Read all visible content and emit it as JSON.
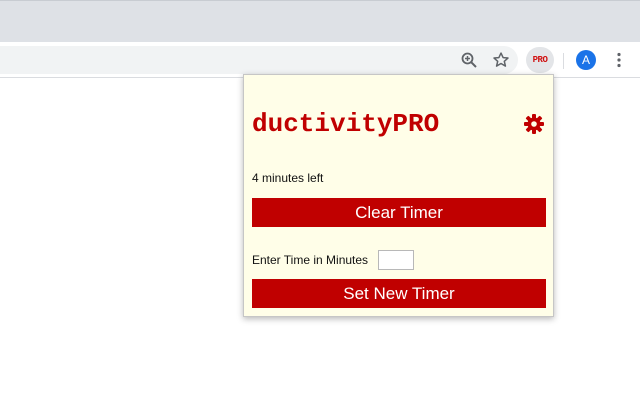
{
  "toolbar": {
    "zoom_icon": "zoom-in-icon",
    "bookmark_icon": "star-icon",
    "extension_badge": "PRO",
    "profile_initial": "A",
    "menu_icon": "more-vert-icon"
  },
  "popup": {
    "brand": "ductivityPRO",
    "settings_icon": "gear-icon",
    "status": "4 minutes left",
    "clear_button": "Clear Timer",
    "time_label": "Enter Time in Minutes",
    "time_value": "",
    "set_button": "Set New Timer"
  },
  "colors": {
    "accent": "#c00000",
    "popup_background": "#fffee8",
    "avatar": "#1a73e8"
  }
}
